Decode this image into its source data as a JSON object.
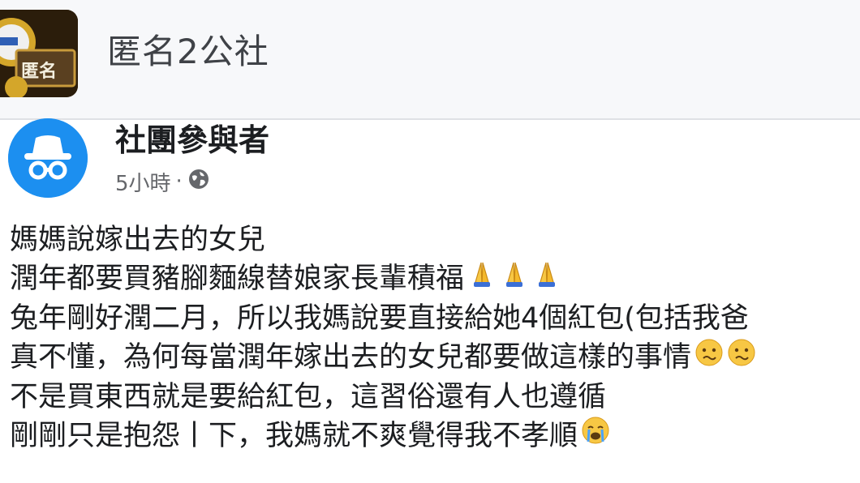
{
  "group": {
    "name": "匿名2公社",
    "avatar_text": "匿名",
    "avatar_icon": "group-logo-icon"
  },
  "post": {
    "author": "社團參與者",
    "author_avatar_icon": "anonymous-member-icon",
    "time": "5小時",
    "separator": "·",
    "privacy_icon": "globe-icon",
    "lines": [
      {
        "text": "媽媽說嫁出去的女兒",
        "emoji": []
      },
      {
        "text": "潤年都要買豬腳麵線替娘家長輩積福",
        "emoji": [
          "folded-hands",
          "folded-hands",
          "folded-hands"
        ]
      },
      {
        "text": "兔年剛好潤二月，所以我媽說要直接給她4個紅包(包括我爸",
        "emoji": []
      },
      {
        "text": "真不懂，為何每當潤年嫁出去的女兒都要做這樣的事情",
        "emoji": [
          "confused-face",
          "confused-face"
        ]
      },
      {
        "text": "不是買東西就是要給紅包，這習俗還有人也遵循",
        "emoji": []
      },
      {
        "text": "剛剛只是抱怨丨下，我媽就不爽覺得我不孝順",
        "emoji": [
          "crying-face"
        ]
      }
    ]
  },
  "colors": {
    "header_bg": "#f7f8fa",
    "text_primary": "#1c1e21",
    "text_secondary": "#65676b",
    "avatar_blue": "#1c8ff0",
    "emoji_yellow": "#f7c744"
  }
}
